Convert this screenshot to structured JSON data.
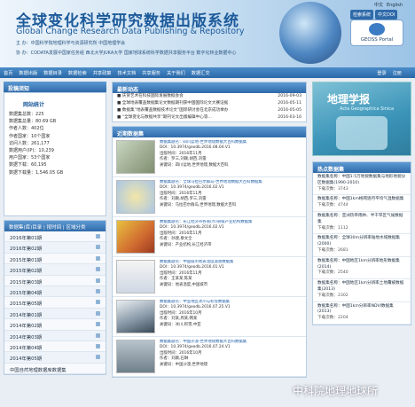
{
  "header": {
    "title_cn": "全球变化科学研究数据出版系统",
    "title_en": "Global Change Research Data Publishing & Repository",
    "line1": "主  办：中国科学院地理科学与资源研究所    中国地理学会",
    "line2": "协  办：CODATA发展中国家任务组    西北大学JUKA大学    国家地球系统科学数据共享服务平台    数字化林业数据中心",
    "lang_cn": "中文",
    "lang_en": "English",
    "tab1": "检索系统",
    "tab2": "中文DOI",
    "geoss": "GEOSS Portal"
  },
  "nav": {
    "items": [
      "首页",
      "数据出版",
      "数据目录",
      "数据检索",
      "共享政策",
      "技术文档",
      "共享服务",
      "关于我们",
      "数据汇交"
    ],
    "right": [
      "登录",
      "注册"
    ]
  },
  "left": {
    "vote": "投稿须知",
    "stats_title": "网站统计",
    "stats": [
      "数据集总数：225",
      "数据集总量：80.69 GB",
      "作者人数：402位",
      "作者国家：10个国家",
      "访问人数：261,177",
      "数据用户(IP)：10,239",
      "用户国家：53个国家",
      "数据下载：60,195",
      "数据下载量：1,546.05 GB"
    ],
    "annual_title": "数据集(库)目录 | 按时间 | 区域分类",
    "years": [
      "2016年第01期",
      "2016年第02期",
      "2015年第01期",
      "2015年第02期",
      "2015年第03期",
      "2015年第04期",
      "2015年第05期",
      "2014年第01期",
      "2014年第02期",
      "2014年第03期",
      "2014年第04期",
      "2014年第05期"
    ],
    "footer": "中国自然地理数据库数据集"
  },
  "mid": {
    "news_title": "最新动态",
    "news": [
      {
        "t": "■ 庆贺艺术在科技国际发展数据会会",
        "d": "2016-09-03"
      },
      {
        "t": "■ 全球地表覆盖数据集论文数据期刊获中国国际论文大赛证据",
        "d": "2016-05-11"
      },
      {
        "t": "■ 数据集“地表覆盖数据技术论文”国际研讨会在北京成功举办",
        "d": "2016-05-05"
      },
      {
        "t": "■ “全球变化与数据共享”期刊论文出版编辑中心等…",
        "d": "2016-03-16"
      }
    ],
    "pub_title": "近期数据集",
    "pubs": [
      {
        "title": "数据集题名：四川盆地-世界地理数据大百科数据集",
        "doi": "DOI：10.3974/geodb.2016.08.04.V1",
        "date": "出版时间：2016年11月",
        "author": "作者：罗三,刘颖,胡西,刘雷",
        "note": "关键词：四川盆地,世界地理,数据大百科"
      },
      {
        "title": "数据集题名：全球马拉巴尔群岛-世界地理数据大百科数据集",
        "doi": "DOI：10.3974/geodb.2016.02.V1",
        "date": "出版时间：2016年11月",
        "author": "作者：刘颖,胡西,罗三,刘雷",
        "note": "关键词：马拉巴尔群岛,世界地理,数据大百科"
      },
      {
        "title": "数据集题名：长江经济带各省(市)县级产业结构数据集",
        "doi": "DOI：10.3974/geodb.2016.02.V1",
        "date": "出版时间：2016年11月",
        "author": "作者：孙建,章文全",
        "note": "关键词：产业结构,长江经济带"
      },
      {
        "title": "数据集题名：中国城市地表温度遥感数据集",
        "doi": "DOI：10.3974/geodb.2016.01.V1",
        "date": "出版时间：2016年11月",
        "author": "作者：王某某,陈某",
        "note": "关键词：地表温度,中国城市"
      },
      {
        "title": "数据集题名：中亚地区冰川与积雪数据集",
        "doi": "DOI：10.3974/geodb.2016.07.25.V1",
        "date": "出版时间：2016年10月",
        "author": "作者：刘某,周某,韩某",
        "note": "关键词：冰川,积雪,中亚"
      },
      {
        "title": "数据集题名：中国沙漠-世界地理数据大百科数据集",
        "doi": "DOI：10.3974/geodb.2016.07.24.V1",
        "date": "出版时间：2016年10月",
        "author": "作者：刘颖,石琳",
        "note": "关键词：中国沙漠,世界地理"
      }
    ]
  },
  "right": {
    "journal_cn": "地理学报",
    "journal_en": "Acta Geographica Sinica",
    "hot_title": "热点数据集",
    "hot": [
      {
        "t": "数据集名称：中国1:5万地貌数据集与地形地貌分区数据集(1990-2010)",
        "d": "下载次数：3743"
      },
      {
        "t": "数据集名称：中国1km格网逐月平均气温数据集",
        "d": "下载次数：4744"
      },
      {
        "t": "数据集名称：亚洲热带雨林、半干旱区气候数据集",
        "d": "下载次数：1112"
      },
      {
        "t": "数据集名称：全球30m分辨率陆地水域数据集(2000)",
        "d": "下载次数：2681"
      },
      {
        "t": "数据集名称：中国地区1km分辨率地形数据集(2014)",
        "d": "下载次数：2540"
      },
      {
        "t": "数据集名称：中国地区1km分辨率土地覆被数据集(2013)",
        "d": "下载次数：2302"
      },
      {
        "t": "数据集名称：中国1km分辨率NDVI数据集(2013)",
        "d": "下载次数：2204"
      }
    ]
  },
  "watermark": "中科院地理地球所"
}
